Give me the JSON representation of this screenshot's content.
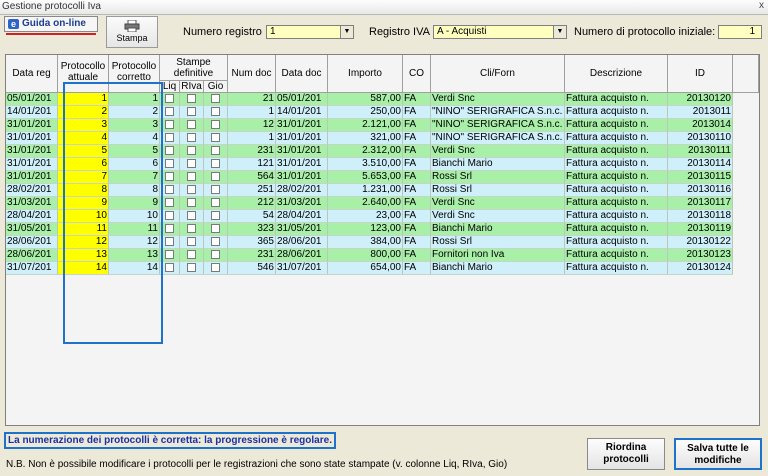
{
  "window": {
    "title": "Gestione protocolli Iva",
    "close_glyph": "x"
  },
  "toolbar": {
    "guida_label": "Guida on-line",
    "guida_icon": "e",
    "stampa_label": "Stampa",
    "numero_registro_label": "Numero registro",
    "numero_registro_value": "1",
    "registro_iva_label": "Registro IVA",
    "registro_iva_value": "A - Acquisti",
    "protocollo_iniziale_label": "Numero di protocollo iniziale:",
    "protocollo_iniziale_value": "1"
  },
  "colors": {
    "selected_row": "#ffff00",
    "row_green": "#a8f0a8",
    "row_blue": "#cfeffb",
    "accent_blue": "#1f72c9"
  },
  "table": {
    "headers": {
      "data_reg": "Data reg",
      "protocollo_attuale": [
        "Protocollo",
        "attuale"
      ],
      "protocollo_corretto": [
        "Protocollo",
        "corretto"
      ],
      "stampe": [
        "Stampe",
        "definitive"
      ],
      "liq": "Liq",
      "riva": "RIva",
      "gio": "Gio",
      "num_doc": "Num doc",
      "data_doc": "Data doc",
      "importo": "Importo",
      "co": "CO",
      "cli_forn": "Cli/Forn",
      "descrizione": "Descrizione",
      "id": "ID"
    },
    "rows": [
      {
        "data_reg": "05/01/201",
        "att": "1",
        "corr": "1",
        "num": "21",
        "data_doc": "05/01/201",
        "importo": "587,00",
        "co": "FA",
        "cli": "Verdi Snc",
        "desc": "Fattura acquisto n.",
        "id": "20130120"
      },
      {
        "data_reg": "14/01/201",
        "att": "2",
        "corr": "2",
        "num": "1",
        "data_doc": "14/01/201",
        "importo": "250,00",
        "co": "FA",
        "cli": "\"NINO\" SERIGRAFICA S.n.c.",
        "desc": "Fattura acquisto n.",
        "id": "2013011"
      },
      {
        "data_reg": "31/01/201",
        "att": "3",
        "corr": "3",
        "num": "12",
        "data_doc": "31/01/201",
        "importo": "2.121,00",
        "co": "FA",
        "cli": "\"NINO\" SERIGRAFICA S.n.c.",
        "desc": "Fattura acquisto n.",
        "id": "2013014"
      },
      {
        "data_reg": "31/01/201",
        "att": "4",
        "corr": "4",
        "num": "1",
        "data_doc": "31/01/201",
        "importo": "321,00",
        "co": "FA",
        "cli": "\"NINO\" SERIGRAFICA S.n.c.",
        "desc": "Fattura acquisto n.",
        "id": "20130110"
      },
      {
        "data_reg": "31/01/201",
        "att": "5",
        "corr": "5",
        "num": "231",
        "data_doc": "31/01/201",
        "importo": "2.312,00",
        "co": "FA",
        "cli": "Verdi Snc",
        "desc": "Fattura acquisto n.",
        "id": "20130111"
      },
      {
        "data_reg": "31/01/201",
        "att": "6",
        "corr": "6",
        "num": "121",
        "data_doc": "31/01/201",
        "importo": "3.510,00",
        "co": "FA",
        "cli": "Bianchi Mario",
        "desc": "Fattura acquisto n.",
        "id": "20130114"
      },
      {
        "data_reg": "31/01/201",
        "att": "7",
        "corr": "7",
        "num": "564",
        "data_doc": "31/01/201",
        "importo": "5.653,00",
        "co": "FA",
        "cli": "Rossi Srl",
        "desc": "Fattura acquisto n.",
        "id": "20130115"
      },
      {
        "data_reg": "28/02/201",
        "att": "8",
        "corr": "8",
        "num": "251",
        "data_doc": "28/02/201",
        "importo": "1.231,00",
        "co": "FA",
        "cli": "Rossi Srl",
        "desc": "Fattura acquisto n.",
        "id": "20130116"
      },
      {
        "data_reg": "31/03/201",
        "att": "9",
        "corr": "9",
        "num": "212",
        "data_doc": "31/03/201",
        "importo": "2.640,00",
        "co": "FA",
        "cli": "Verdi Snc",
        "desc": "Fattura acquisto n.",
        "id": "20130117"
      },
      {
        "data_reg": "28/04/201",
        "att": "10",
        "corr": "10",
        "num": "54",
        "data_doc": "28/04/201",
        "importo": "23,00",
        "co": "FA",
        "cli": "Verdi Snc",
        "desc": "Fattura acquisto n.",
        "id": "20130118"
      },
      {
        "data_reg": "31/05/201",
        "att": "11",
        "corr": "11",
        "num": "323",
        "data_doc": "31/05/201",
        "importo": "123,00",
        "co": "FA",
        "cli": "Bianchi Mario",
        "desc": "Fattura acquisto n.",
        "id": "20130119"
      },
      {
        "data_reg": "28/06/201",
        "att": "12",
        "corr": "12",
        "num": "365",
        "data_doc": "28/06/201",
        "importo": "384,00",
        "co": "FA",
        "cli": "Rossi Srl",
        "desc": "Fattura acquisto n.",
        "id": "20130122"
      },
      {
        "data_reg": "28/06/201",
        "att": "13",
        "corr": "13",
        "num": "231",
        "data_doc": "28/06/201",
        "importo": "800,00",
        "co": "FA",
        "cli": "Fornitori non Iva",
        "desc": "Fattura acquisto n.",
        "id": "20130123"
      },
      {
        "data_reg": "31/07/201",
        "att": "14",
        "corr": "14",
        "num": "546",
        "data_doc": "31/07/201",
        "importo": "654,00",
        "co": "FA",
        "cli": "Bianchi Mario",
        "desc": "Fattura acquisto n.",
        "id": "20130124"
      }
    ]
  },
  "status": {
    "message": "La numerazione dei protocolli è corretta: la progressione è regolare.",
    "note": "N.B. Non è possibile modificare i protocolli per le registrazioni che sono state stampate (v. colonne Liq, RIva, Gio)"
  },
  "buttons": {
    "riordina": [
      "Riordina",
      "protocolli"
    ],
    "salva": [
      "Salva tutte le",
      "modifiche"
    ]
  }
}
